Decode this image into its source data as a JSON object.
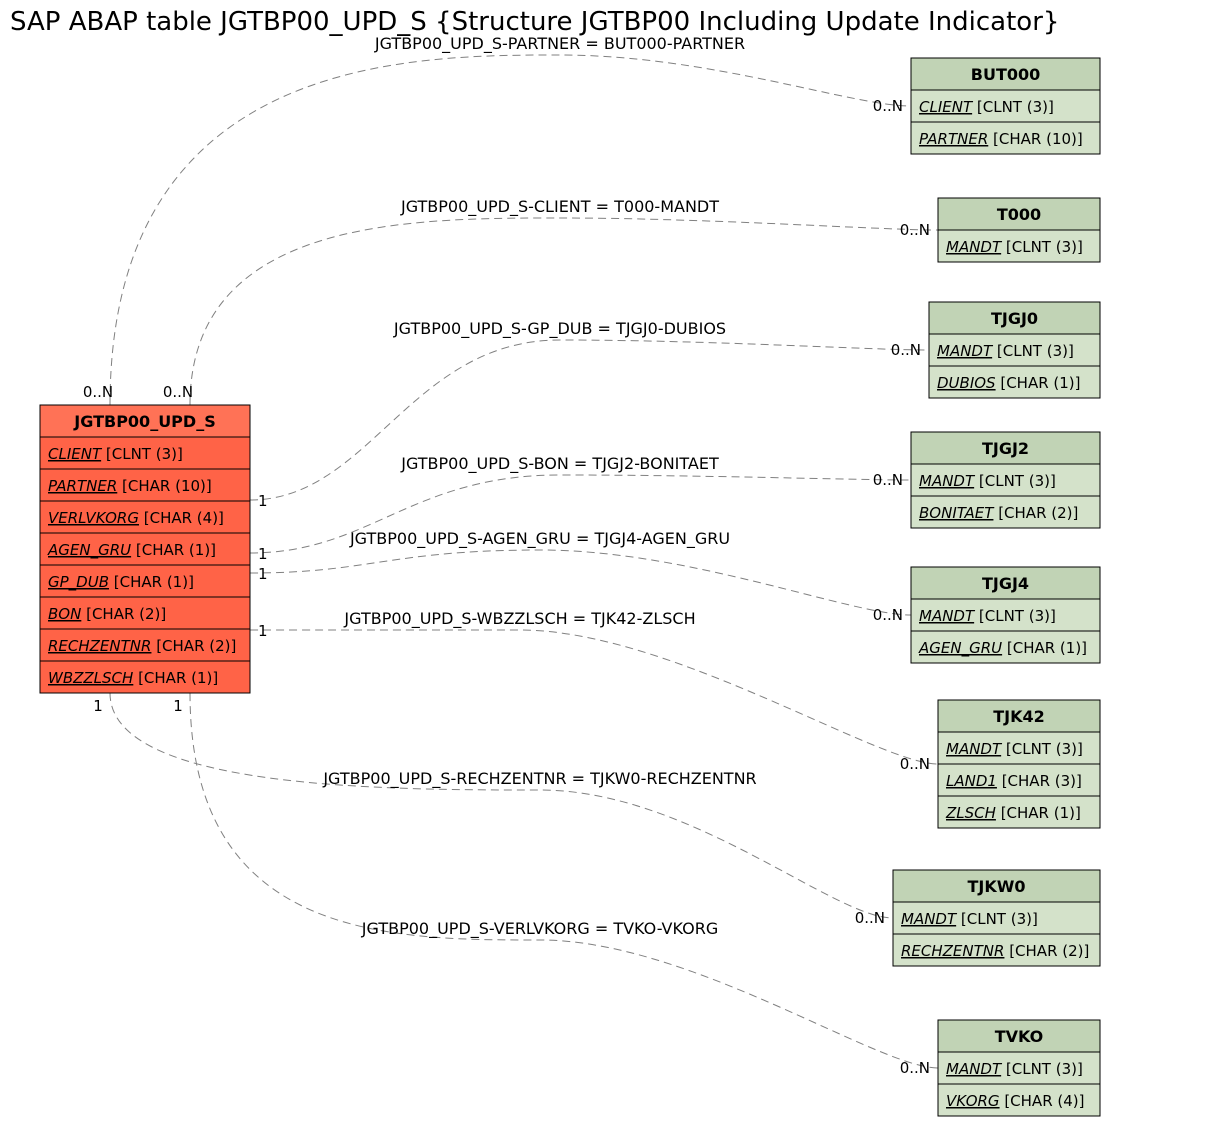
{
  "title": "SAP ABAP table JGTBP00_UPD_S {Structure JGTBP00 Including Update Indicator}",
  "main_entity": {
    "name": "JGTBP00_UPD_S",
    "header_bg": "#ff7256",
    "body_bg": "#ff6347",
    "fields": [
      {
        "name": "CLIENT",
        "type": "[CLNT (3)]"
      },
      {
        "name": "PARTNER",
        "type": "[CHAR (10)]"
      },
      {
        "name": "VERLVKORG",
        "type": "[CHAR (4)]"
      },
      {
        "name": "AGEN_GRU",
        "type": "[CHAR (1)]"
      },
      {
        "name": "GP_DUB",
        "type": "[CHAR (1)]"
      },
      {
        "name": "BON",
        "type": "[CHAR (2)]"
      },
      {
        "name": "RECHZENTNR",
        "type": "[CHAR (2)]"
      },
      {
        "name": "WBZZLSCH",
        "type": "[CHAR (1)]"
      }
    ]
  },
  "related_entities": [
    {
      "name": "BUT000",
      "fields": [
        {
          "name": "CLIENT",
          "type": "[CLNT (3)]"
        },
        {
          "name": "PARTNER",
          "type": "[CHAR (10)]"
        }
      ]
    },
    {
      "name": "T000",
      "fields": [
        {
          "name": "MANDT",
          "type": "[CLNT (3)]"
        }
      ]
    },
    {
      "name": "TJGJ0",
      "fields": [
        {
          "name": "MANDT",
          "type": "[CLNT (3)]"
        },
        {
          "name": "DUBIOS",
          "type": "[CHAR (1)]"
        }
      ]
    },
    {
      "name": "TJGJ2",
      "fields": [
        {
          "name": "MANDT",
          "type": "[CLNT (3)]"
        },
        {
          "name": "BONITAET",
          "type": "[CHAR (2)]"
        }
      ]
    },
    {
      "name": "TJGJ4",
      "fields": [
        {
          "name": "MANDT",
          "type": "[CLNT (3)]"
        },
        {
          "name": "AGEN_GRU",
          "type": "[CHAR (1)]"
        }
      ]
    },
    {
      "name": "TJK42",
      "fields": [
        {
          "name": "MANDT",
          "type": "[CLNT (3)]"
        },
        {
          "name": "LAND1",
          "type": "[CHAR (3)]"
        },
        {
          "name": "ZLSCH",
          "type": "[CHAR (1)]"
        }
      ]
    },
    {
      "name": "TJKW0",
      "fields": [
        {
          "name": "MANDT",
          "type": "[CLNT (3)]"
        },
        {
          "name": "RECHZENTNR",
          "type": "[CHAR (2)]"
        }
      ]
    },
    {
      "name": "TVKO",
      "fields": [
        {
          "name": "MANDT",
          "type": "[CLNT (3)]"
        },
        {
          "name": "VKORG",
          "type": "[CHAR (4)]"
        }
      ]
    }
  ],
  "green_header_bg": "#c1d3b5",
  "green_body_bg": "#d4e2ca",
  "relations": [
    {
      "label": "JGTBP00_UPD_S-PARTNER = BUT000-PARTNER",
      "left_card": "0..N",
      "right_card": "0..N"
    },
    {
      "label": "JGTBP00_UPD_S-CLIENT = T000-MANDT",
      "left_card": "0..N",
      "right_card": "0..N"
    },
    {
      "label": "JGTBP00_UPD_S-GP_DUB = TJGJ0-DUBIOS",
      "left_card": "1",
      "right_card": "0..N"
    },
    {
      "label": "JGTBP00_UPD_S-BON = TJGJ2-BONITAET",
      "left_card": "1",
      "right_card": "0..N"
    },
    {
      "label": "JGTBP00_UPD_S-AGEN_GRU = TJGJ4-AGEN_GRU",
      "left_card": "1",
      "right_card": "0..N"
    },
    {
      "label": "JGTBP00_UPD_S-WBZZLSCH = TJK42-ZLSCH",
      "left_card": "1",
      "right_card": "0..N"
    },
    {
      "label": "JGTBP00_UPD_S-RECHZENTNR = TJKW0-RECHZENTNR",
      "left_card": "1",
      "right_card": "0..N"
    },
    {
      "label": "JGTBP00_UPD_S-VERLVKORG = TVKO-VKORG",
      "left_card": "1",
      "right_card": "0..N"
    }
  ]
}
